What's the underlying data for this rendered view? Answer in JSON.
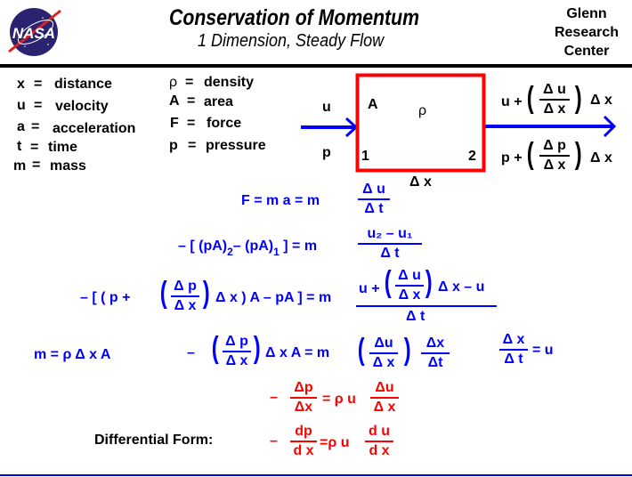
{
  "header": {
    "logo": "NASA",
    "title": "Conservation  of  Momentum",
    "subtitle": "1  Dimension,  Steady Flow",
    "center_lines": [
      "Glenn",
      "Research",
      "Center"
    ]
  },
  "legend": {
    "left": [
      {
        "sym": "x",
        "eq": "=",
        "desc": "distance"
      },
      {
        "sym": "u",
        "eq": "=",
        "desc": "velocity"
      },
      {
        "sym": "a",
        "eq": "=",
        "desc": "acceleration"
      },
      {
        "sym": "t",
        "eq": "=",
        "desc": "time"
      },
      {
        "sym": "m",
        "eq": "=",
        "desc": "mass"
      }
    ],
    "right": [
      {
        "sym": "ρ",
        "eq": "=",
        "desc": "density"
      },
      {
        "sym": "A",
        "eq": "=",
        "desc": "area"
      },
      {
        "sym": "F",
        "eq": "=",
        "desc": "force"
      },
      {
        "sym": "p",
        "eq": "=",
        "desc": "pressure"
      }
    ]
  },
  "diagram": {
    "inlet_u": "u",
    "inlet_p": "p",
    "box_A": "A",
    "box_rho": "ρ",
    "station1": "1",
    "station2": "2",
    "width_label": "Δ x",
    "outlet_u": {
      "lead": "u +",
      "num": "Δ u",
      "den": "Δ x",
      "tail": "Δ x"
    },
    "outlet_p": {
      "lead": "p +",
      "num": "Δ p",
      "den": "Δ x",
      "tail": "Δ x"
    },
    "colors": {
      "box": "#ff0000",
      "arrow": "#0000ff"
    }
  },
  "equations": {
    "eq1": {
      "lhs": "F  =  m a  =  m",
      "num": "Δ u",
      "den": "Δ  t"
    },
    "eq2": {
      "lhs_a": "– [ (pA)",
      "sub2": "2",
      "lhs_b": "– (pA)",
      "sub1": "1",
      "lhs_c": " ] =  m",
      "num": "u₂  – u₁",
      "den": "Δ t"
    },
    "eq3": {
      "lead": "–  [ ( p +",
      "pnum": "Δ p",
      "pden": "Δ x",
      "mid": "Δ x ) A  – pA ]  = m",
      "num_lead": "u +",
      "unum": "Δ u",
      "uden": "Δ x",
      "num_tail": "Δ x  –  u",
      "den": "Δ t"
    },
    "mass": {
      "text": "m  = ρ Δ x  A"
    },
    "eq4": {
      "lead": "–",
      "pnum": "Δ p",
      "pden": "Δ x",
      "mid": "Δ x  A  =  m",
      "unum": "Δu",
      "uden": "Δ x",
      "xnum": "Δx",
      "xden": "Δt"
    },
    "velocity": {
      "num": "Δ x",
      "den": "Δ t",
      "rhs": "= u"
    },
    "eq5": {
      "lead": "–",
      "pnum": "Δp",
      "pden": "Δx",
      "mid": "= ρ u",
      "unum": "Δu",
      "uden": "Δ x"
    },
    "differential": {
      "label": "Differential  Form:",
      "lead": "–",
      "pnum": "dp",
      "pden": "d x",
      "mid": "=ρ  u",
      "unum": "d u",
      "uden": "d x"
    }
  },
  "colors": {
    "primary": "#0000ff",
    "result": "#ff0000",
    "text": "#000000"
  }
}
